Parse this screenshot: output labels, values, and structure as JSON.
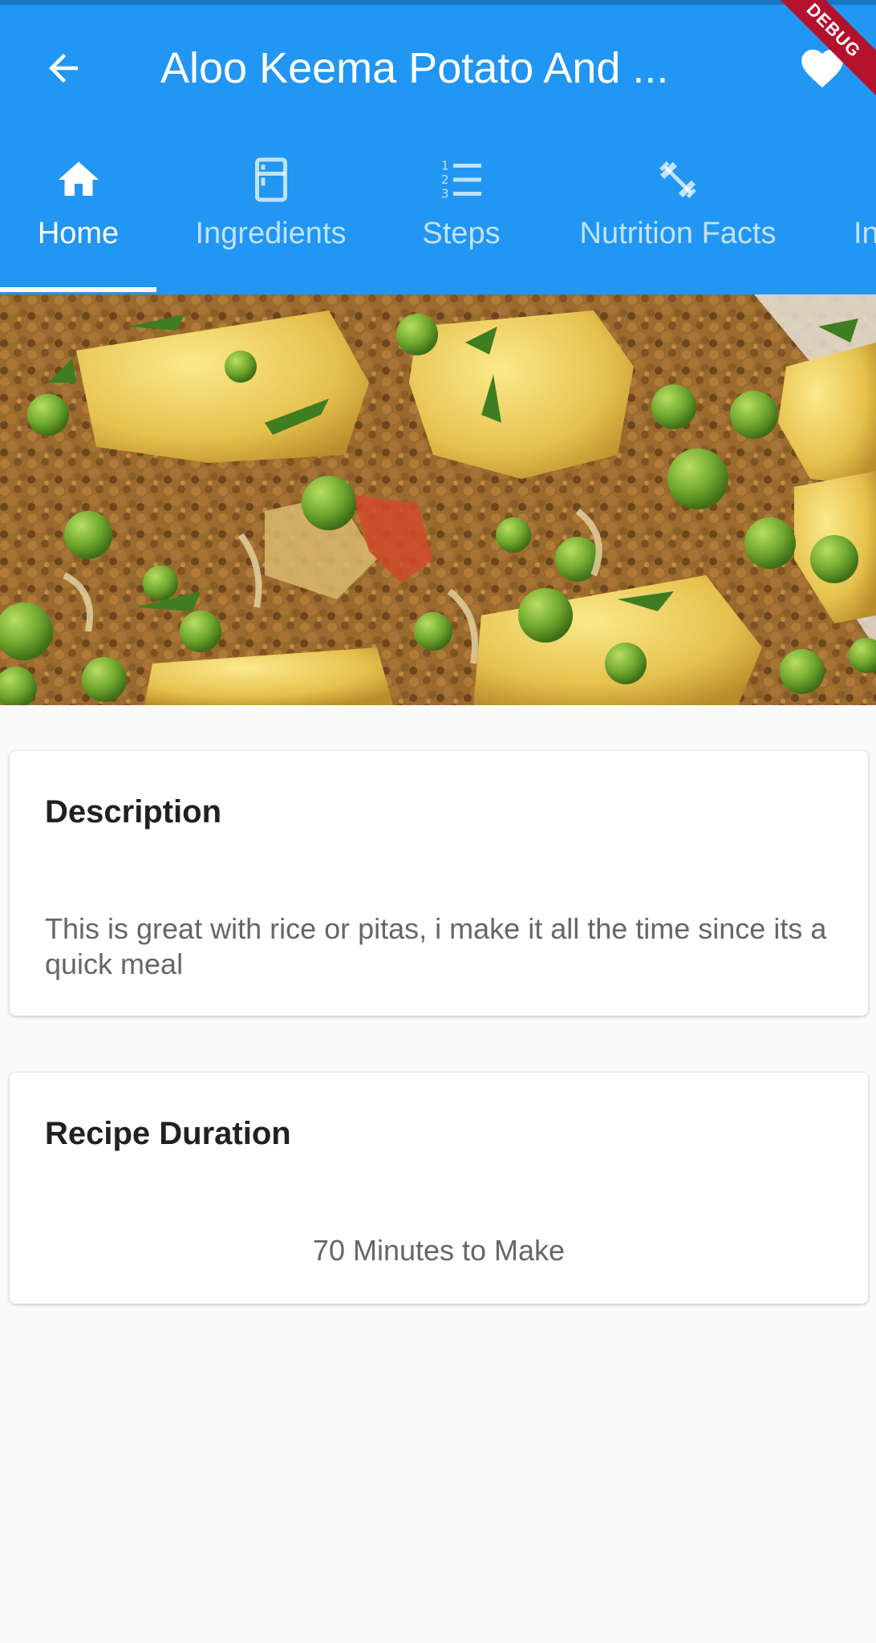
{
  "appbar": {
    "title": "Aloo Keema Potato And ...",
    "back_icon": "arrow-back-icon",
    "favorite_icon": "heart-icon",
    "debug_banner": "DEBUG",
    "color": "#2196f3"
  },
  "tabs": [
    {
      "label": "Home",
      "icon": "home-icon",
      "active": true
    },
    {
      "label": "Ingredients",
      "icon": "fridge-icon",
      "active": false
    },
    {
      "label": "Steps",
      "icon": "numbered-list-icon",
      "active": false
    },
    {
      "label": "Nutrition Facts",
      "icon": "fitness-icon",
      "active": false
    },
    {
      "label": "In",
      "icon": "info-icon",
      "active": false
    }
  ],
  "hero": {
    "description": "photo of aloo keema with potatoes, peas and minced meat"
  },
  "description_card": {
    "title": "Description",
    "text": "This is great with rice or pitas, i make it all the time since its a quick meal"
  },
  "duration_card": {
    "title": "Recipe Duration",
    "text": "70 Minutes to Make"
  }
}
